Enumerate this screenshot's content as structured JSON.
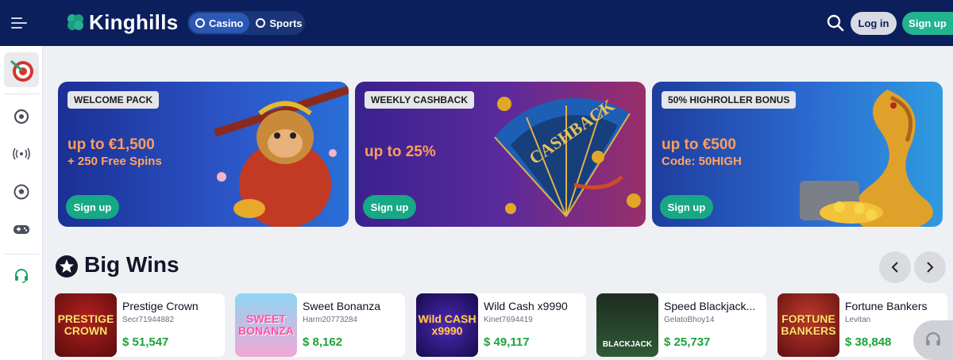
{
  "header": {
    "logo": "Kinghills",
    "tabs": [
      {
        "label": "Casino",
        "icon": "casino-chip-icon",
        "active": true
      },
      {
        "label": "Sports",
        "icon": "soccer-ball-icon",
        "active": false
      }
    ],
    "login_label": "Log in",
    "signup_label": "Sign up"
  },
  "sidebar": {
    "items": [
      {
        "icon": "dartboard-icon",
        "active": true
      },
      {
        "icon": "casino-chip-icon"
      },
      {
        "icon": "live-broadcast-icon"
      },
      {
        "icon": "soccer-ball-icon"
      },
      {
        "icon": "gamepad-icon"
      },
      {
        "icon": "support-headset-icon"
      }
    ]
  },
  "promos": [
    {
      "badge": "WELCOME PACK",
      "main": "up to €1,500",
      "sub": "+ 250 Free Spins",
      "button": "Sign up",
      "art": "monkey-king-icon"
    },
    {
      "badge": "WEEKLY CASHBACK",
      "main": "up to 25%",
      "sub": "",
      "button": "Sign up",
      "art": "cashback-fan-icon"
    },
    {
      "badge": "50% HIGHROLLER BONUS",
      "main": "up to €500",
      "sub": "Code: 50HIGH",
      "button": "Sign up",
      "art": "golden-dragon-icon"
    }
  ],
  "big_wins": {
    "title": "Big Wins",
    "items": [
      {
        "game": "Prestige Crown",
        "user": "Secr71944882",
        "amount": "$ 51,547",
        "thumb": "PRESTIGE CROWN"
      },
      {
        "game": "Sweet Bonanza",
        "user": "Harm20773284",
        "amount": "$ 8,162",
        "thumb": "SWEET BONANZA"
      },
      {
        "game": "Wild Cash x9990",
        "user": "Kinet7694419",
        "amount": "$ 49,117",
        "thumb": "Wild CASH x9990"
      },
      {
        "game": "Speed Blackjack...",
        "user": "GelatoBhoy14",
        "amount": "$ 25,737",
        "thumb": "BLACKJACK"
      },
      {
        "game": "Fortune Bankers",
        "user": "Levitan",
        "amount": "$ 38,848",
        "thumb": "FORTUNE BANKERS"
      }
    ]
  },
  "colors": {
    "header": "#0b1f5c",
    "accent": "#22b38f",
    "win": "#1ca33a"
  }
}
